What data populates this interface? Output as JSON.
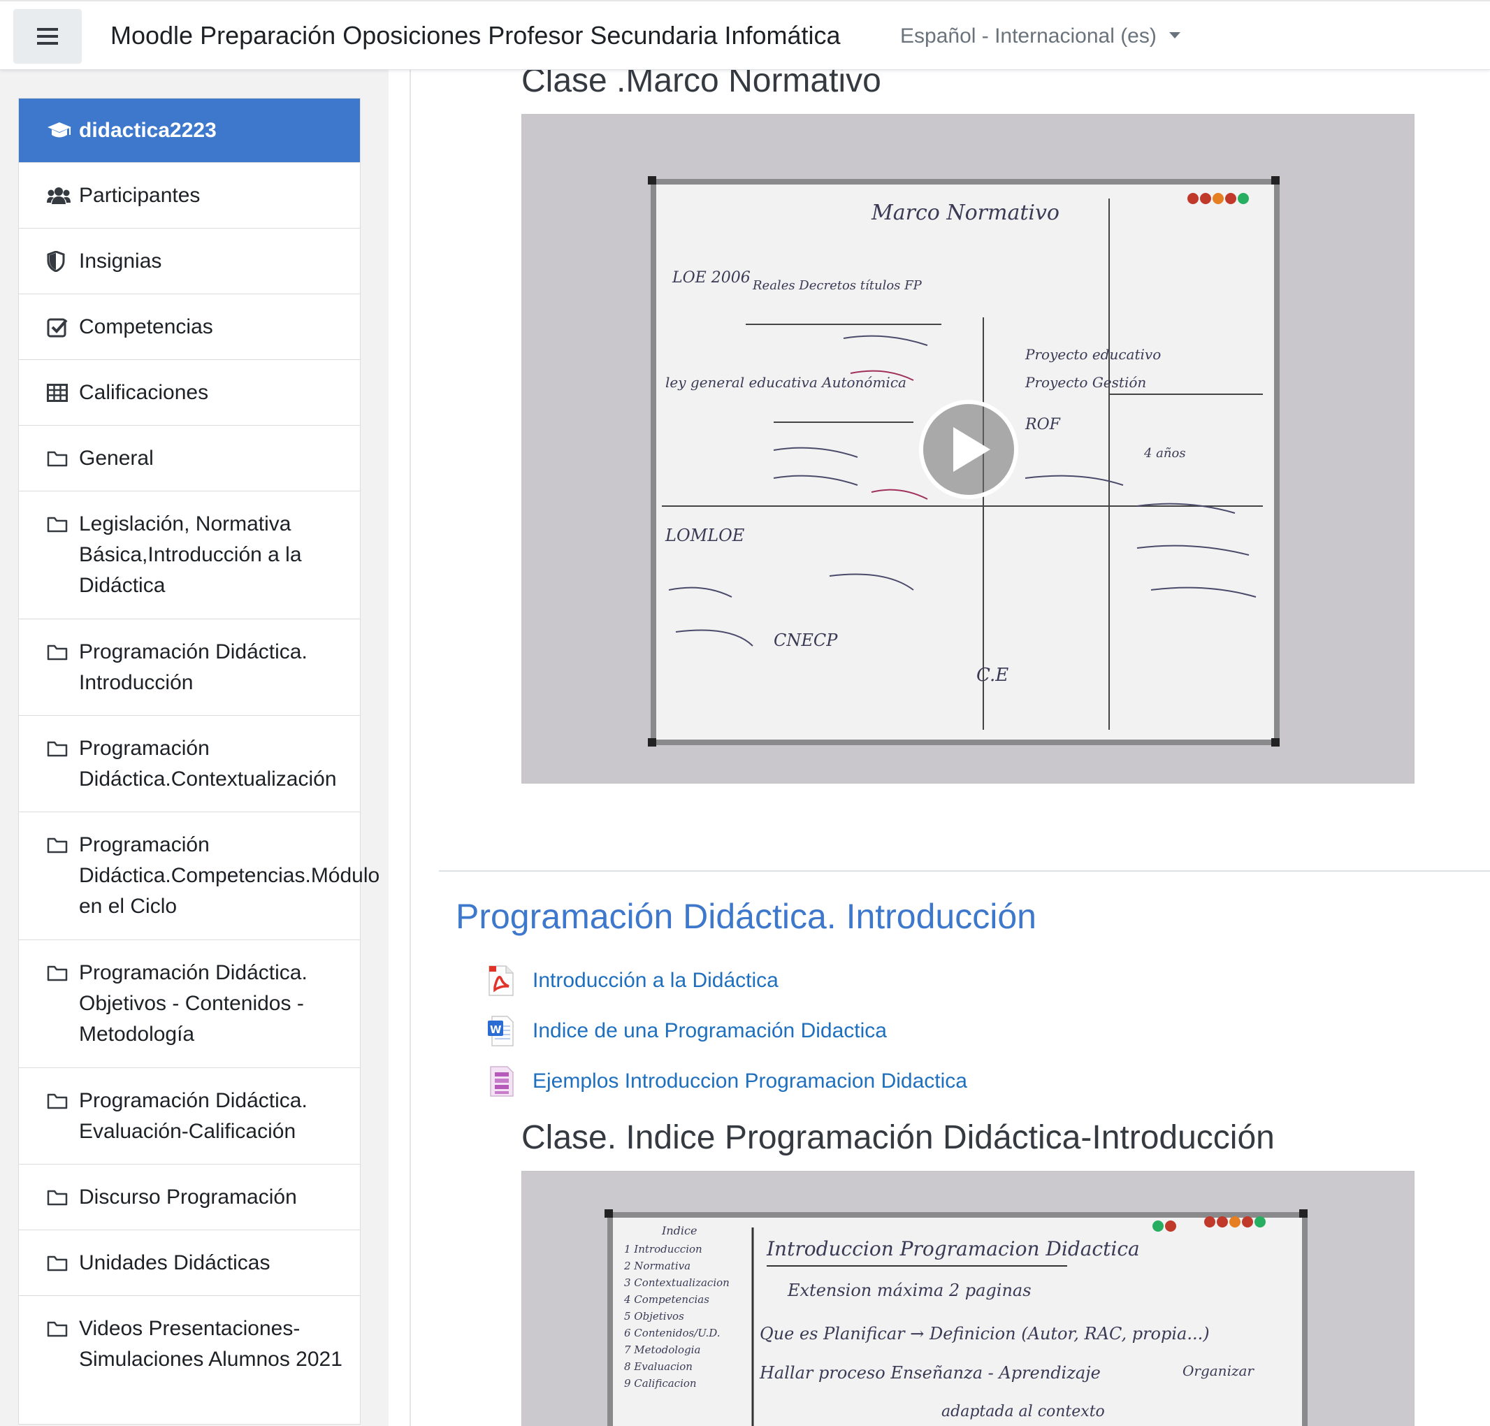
{
  "navbar": {
    "menu_icon": "hamburger-icon",
    "site_title": "Moodle Preparación Oposiciones Profesor Secundaria Infomática",
    "language": "Español - Internacional (es)"
  },
  "sidebar": {
    "items": [
      {
        "label": "didactica2223",
        "icon": "graduation-cap-icon"
      },
      {
        "label": "Participantes",
        "icon": "users-icon"
      },
      {
        "label": "Insignias",
        "icon": "shield-icon"
      },
      {
        "label": "Competencias",
        "icon": "checkbox-icon"
      },
      {
        "label": "Calificaciones",
        "icon": "table-icon"
      },
      {
        "label": "General",
        "icon": "folder-icon"
      },
      {
        "label": "Legislación, Normativa Básica,Introducción a la Didáctica",
        "icon": "folder-icon"
      },
      {
        "label": "Programación Didáctica. Introducción",
        "icon": "folder-icon"
      },
      {
        "label": "Programación Didáctica.Contextualización",
        "icon": "folder-icon"
      },
      {
        "label": "Programación Didáctica.Competencias.Módulo en el Ciclo",
        "icon": "folder-icon"
      },
      {
        "label": "Programación Didáctica. Objetivos - Contenidos - Metodología",
        "icon": "folder-icon"
      },
      {
        "label": "Programación Didáctica. Evaluación-Calificación",
        "icon": "folder-icon"
      },
      {
        "label": "Discurso Programación",
        "icon": "folder-icon"
      },
      {
        "label": "Unidades Didácticas",
        "icon": "folder-icon"
      },
      {
        "label": "Videos Presentaciones- Simulaciones Alumnos 2021",
        "icon": "folder-icon"
      }
    ]
  },
  "main": {
    "video1": {
      "title": "Clase .Marco Normativo",
      "board_heading": "Marco Normativo",
      "board_notes": [
        "LOE 2006",
        "Reales Decretos títulos FP",
        "ley general educativa Autonómica",
        "LOMLOE",
        "Proyecto educativo",
        "Proyecto Gestión",
        "ROF",
        "4 años",
        "C.E",
        "CNECP"
      ]
    },
    "section": {
      "title": "Programación Didáctica. Introducción",
      "activities": [
        {
          "label": "Introducción a la Didáctica",
          "icon": "pdf-icon",
          "color": "#e0342b"
        },
        {
          "label": "Indice de una Programación Didactica",
          "icon": "word-doc-icon",
          "color": "#2b6cd4"
        },
        {
          "label": "Ejemplos Introduccion Programacion Didactica",
          "icon": "archive-icon",
          "color": "#b55ab8"
        }
      ]
    },
    "video2": {
      "title": "Clase. Indice Programación Didáctica-Introducción",
      "board_heading": "Introduccion Programacion Didactica",
      "board_index": [
        "Indice",
        "1 Introduccion",
        "2 Normativa",
        "3 Contextualizacion",
        "4 Competencias",
        "5 Objetivos",
        "6 Contenidos/U.D.",
        "7 Metodologia",
        "8 Evaluacion",
        "9 Calificacion"
      ],
      "board_notes": [
        "Extension máxima 2 paginas",
        "Que es Planificar → Definicion (Autor, RAC, propia...)",
        "Hallar proceso Enseñanza - Aprendizaje",
        "Organizar",
        "adaptada al contexto"
      ]
    }
  },
  "colors": {
    "accent": "#3d78cc",
    "link": "#1f6fbf",
    "sidebar_bg": "#f2f2f2"
  }
}
